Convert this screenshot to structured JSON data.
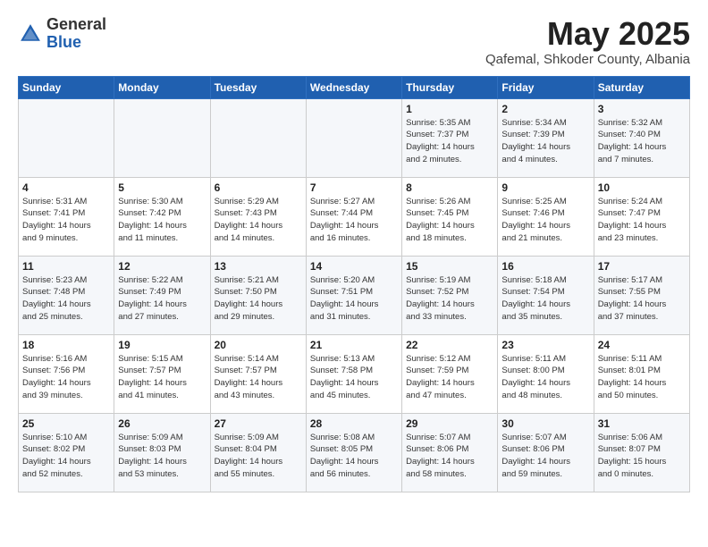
{
  "header": {
    "logo_general": "General",
    "logo_blue": "Blue",
    "month_title": "May 2025",
    "subtitle": "Qafemal, Shkoder County, Albania"
  },
  "days_of_week": [
    "Sunday",
    "Monday",
    "Tuesday",
    "Wednesday",
    "Thursday",
    "Friday",
    "Saturday"
  ],
  "weeks": [
    [
      {
        "day": "",
        "info": ""
      },
      {
        "day": "",
        "info": ""
      },
      {
        "day": "",
        "info": ""
      },
      {
        "day": "",
        "info": ""
      },
      {
        "day": "1",
        "info": "Sunrise: 5:35 AM\nSunset: 7:37 PM\nDaylight: 14 hours\nand 2 minutes."
      },
      {
        "day": "2",
        "info": "Sunrise: 5:34 AM\nSunset: 7:39 PM\nDaylight: 14 hours\nand 4 minutes."
      },
      {
        "day": "3",
        "info": "Sunrise: 5:32 AM\nSunset: 7:40 PM\nDaylight: 14 hours\nand 7 minutes."
      }
    ],
    [
      {
        "day": "4",
        "info": "Sunrise: 5:31 AM\nSunset: 7:41 PM\nDaylight: 14 hours\nand 9 minutes."
      },
      {
        "day": "5",
        "info": "Sunrise: 5:30 AM\nSunset: 7:42 PM\nDaylight: 14 hours\nand 11 minutes."
      },
      {
        "day": "6",
        "info": "Sunrise: 5:29 AM\nSunset: 7:43 PM\nDaylight: 14 hours\nand 14 minutes."
      },
      {
        "day": "7",
        "info": "Sunrise: 5:27 AM\nSunset: 7:44 PM\nDaylight: 14 hours\nand 16 minutes."
      },
      {
        "day": "8",
        "info": "Sunrise: 5:26 AM\nSunset: 7:45 PM\nDaylight: 14 hours\nand 18 minutes."
      },
      {
        "day": "9",
        "info": "Sunrise: 5:25 AM\nSunset: 7:46 PM\nDaylight: 14 hours\nand 21 minutes."
      },
      {
        "day": "10",
        "info": "Sunrise: 5:24 AM\nSunset: 7:47 PM\nDaylight: 14 hours\nand 23 minutes."
      }
    ],
    [
      {
        "day": "11",
        "info": "Sunrise: 5:23 AM\nSunset: 7:48 PM\nDaylight: 14 hours\nand 25 minutes."
      },
      {
        "day": "12",
        "info": "Sunrise: 5:22 AM\nSunset: 7:49 PM\nDaylight: 14 hours\nand 27 minutes."
      },
      {
        "day": "13",
        "info": "Sunrise: 5:21 AM\nSunset: 7:50 PM\nDaylight: 14 hours\nand 29 minutes."
      },
      {
        "day": "14",
        "info": "Sunrise: 5:20 AM\nSunset: 7:51 PM\nDaylight: 14 hours\nand 31 minutes."
      },
      {
        "day": "15",
        "info": "Sunrise: 5:19 AM\nSunset: 7:52 PM\nDaylight: 14 hours\nand 33 minutes."
      },
      {
        "day": "16",
        "info": "Sunrise: 5:18 AM\nSunset: 7:54 PM\nDaylight: 14 hours\nand 35 minutes."
      },
      {
        "day": "17",
        "info": "Sunrise: 5:17 AM\nSunset: 7:55 PM\nDaylight: 14 hours\nand 37 minutes."
      }
    ],
    [
      {
        "day": "18",
        "info": "Sunrise: 5:16 AM\nSunset: 7:56 PM\nDaylight: 14 hours\nand 39 minutes."
      },
      {
        "day": "19",
        "info": "Sunrise: 5:15 AM\nSunset: 7:57 PM\nDaylight: 14 hours\nand 41 minutes."
      },
      {
        "day": "20",
        "info": "Sunrise: 5:14 AM\nSunset: 7:57 PM\nDaylight: 14 hours\nand 43 minutes."
      },
      {
        "day": "21",
        "info": "Sunrise: 5:13 AM\nSunset: 7:58 PM\nDaylight: 14 hours\nand 45 minutes."
      },
      {
        "day": "22",
        "info": "Sunrise: 5:12 AM\nSunset: 7:59 PM\nDaylight: 14 hours\nand 47 minutes."
      },
      {
        "day": "23",
        "info": "Sunrise: 5:11 AM\nSunset: 8:00 PM\nDaylight: 14 hours\nand 48 minutes."
      },
      {
        "day": "24",
        "info": "Sunrise: 5:11 AM\nSunset: 8:01 PM\nDaylight: 14 hours\nand 50 minutes."
      }
    ],
    [
      {
        "day": "25",
        "info": "Sunrise: 5:10 AM\nSunset: 8:02 PM\nDaylight: 14 hours\nand 52 minutes."
      },
      {
        "day": "26",
        "info": "Sunrise: 5:09 AM\nSunset: 8:03 PM\nDaylight: 14 hours\nand 53 minutes."
      },
      {
        "day": "27",
        "info": "Sunrise: 5:09 AM\nSunset: 8:04 PM\nDaylight: 14 hours\nand 55 minutes."
      },
      {
        "day": "28",
        "info": "Sunrise: 5:08 AM\nSunset: 8:05 PM\nDaylight: 14 hours\nand 56 minutes."
      },
      {
        "day": "29",
        "info": "Sunrise: 5:07 AM\nSunset: 8:06 PM\nDaylight: 14 hours\nand 58 minutes."
      },
      {
        "day": "30",
        "info": "Sunrise: 5:07 AM\nSunset: 8:06 PM\nDaylight: 14 hours\nand 59 minutes."
      },
      {
        "day": "31",
        "info": "Sunrise: 5:06 AM\nSunset: 8:07 PM\nDaylight: 15 hours\nand 0 minutes."
      }
    ]
  ]
}
